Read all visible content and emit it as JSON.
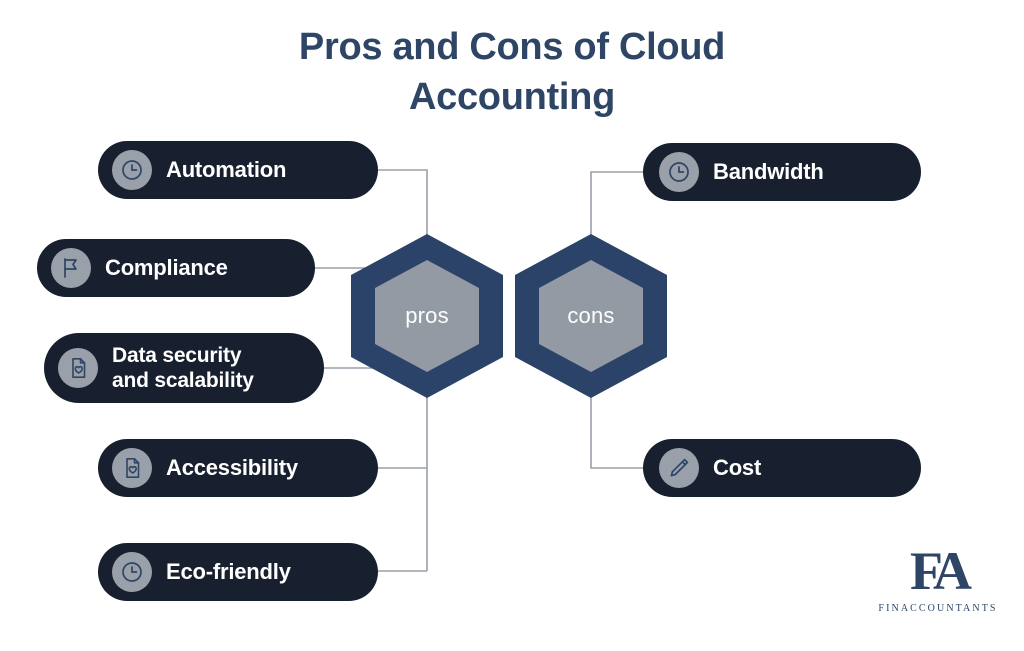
{
  "title": {
    "line1": "Pros and Cons of Cloud",
    "line2": "Accounting"
  },
  "colors": {
    "background": "#ffffff",
    "title": "#2e4566",
    "pill_fill": "#18202f",
    "pill_text": "#ffffff",
    "icon_circle": "#9aa0aa",
    "icon_stroke": "#2e4566",
    "hex_outer": "#2b4368",
    "hex_inner": "#949aa4",
    "hex_text": "#ffffff",
    "connector_line": "#9aa0aa",
    "logo": "#2e4566"
  },
  "hubs": [
    {
      "id": "pros",
      "label": "pros"
    },
    {
      "id": "cons",
      "label": "cons"
    }
  ],
  "pros": [
    {
      "label": "Automation",
      "icon": "clock-icon"
    },
    {
      "label": "Compliance",
      "icon": "flag-icon"
    },
    {
      "label": "Data security\nand scalability",
      "icon": "document-heart-icon"
    },
    {
      "label": "Accessibility",
      "icon": "document-heart-icon"
    },
    {
      "label": "Eco-friendly",
      "icon": "clock-icon"
    }
  ],
  "cons": [
    {
      "label": "Bandwidth",
      "icon": "clock-icon"
    },
    {
      "label": "Cost",
      "icon": "pencil-icon"
    }
  ],
  "logo": {
    "mark": "FA",
    "wordmark": "FINACCOUNTANTS"
  }
}
